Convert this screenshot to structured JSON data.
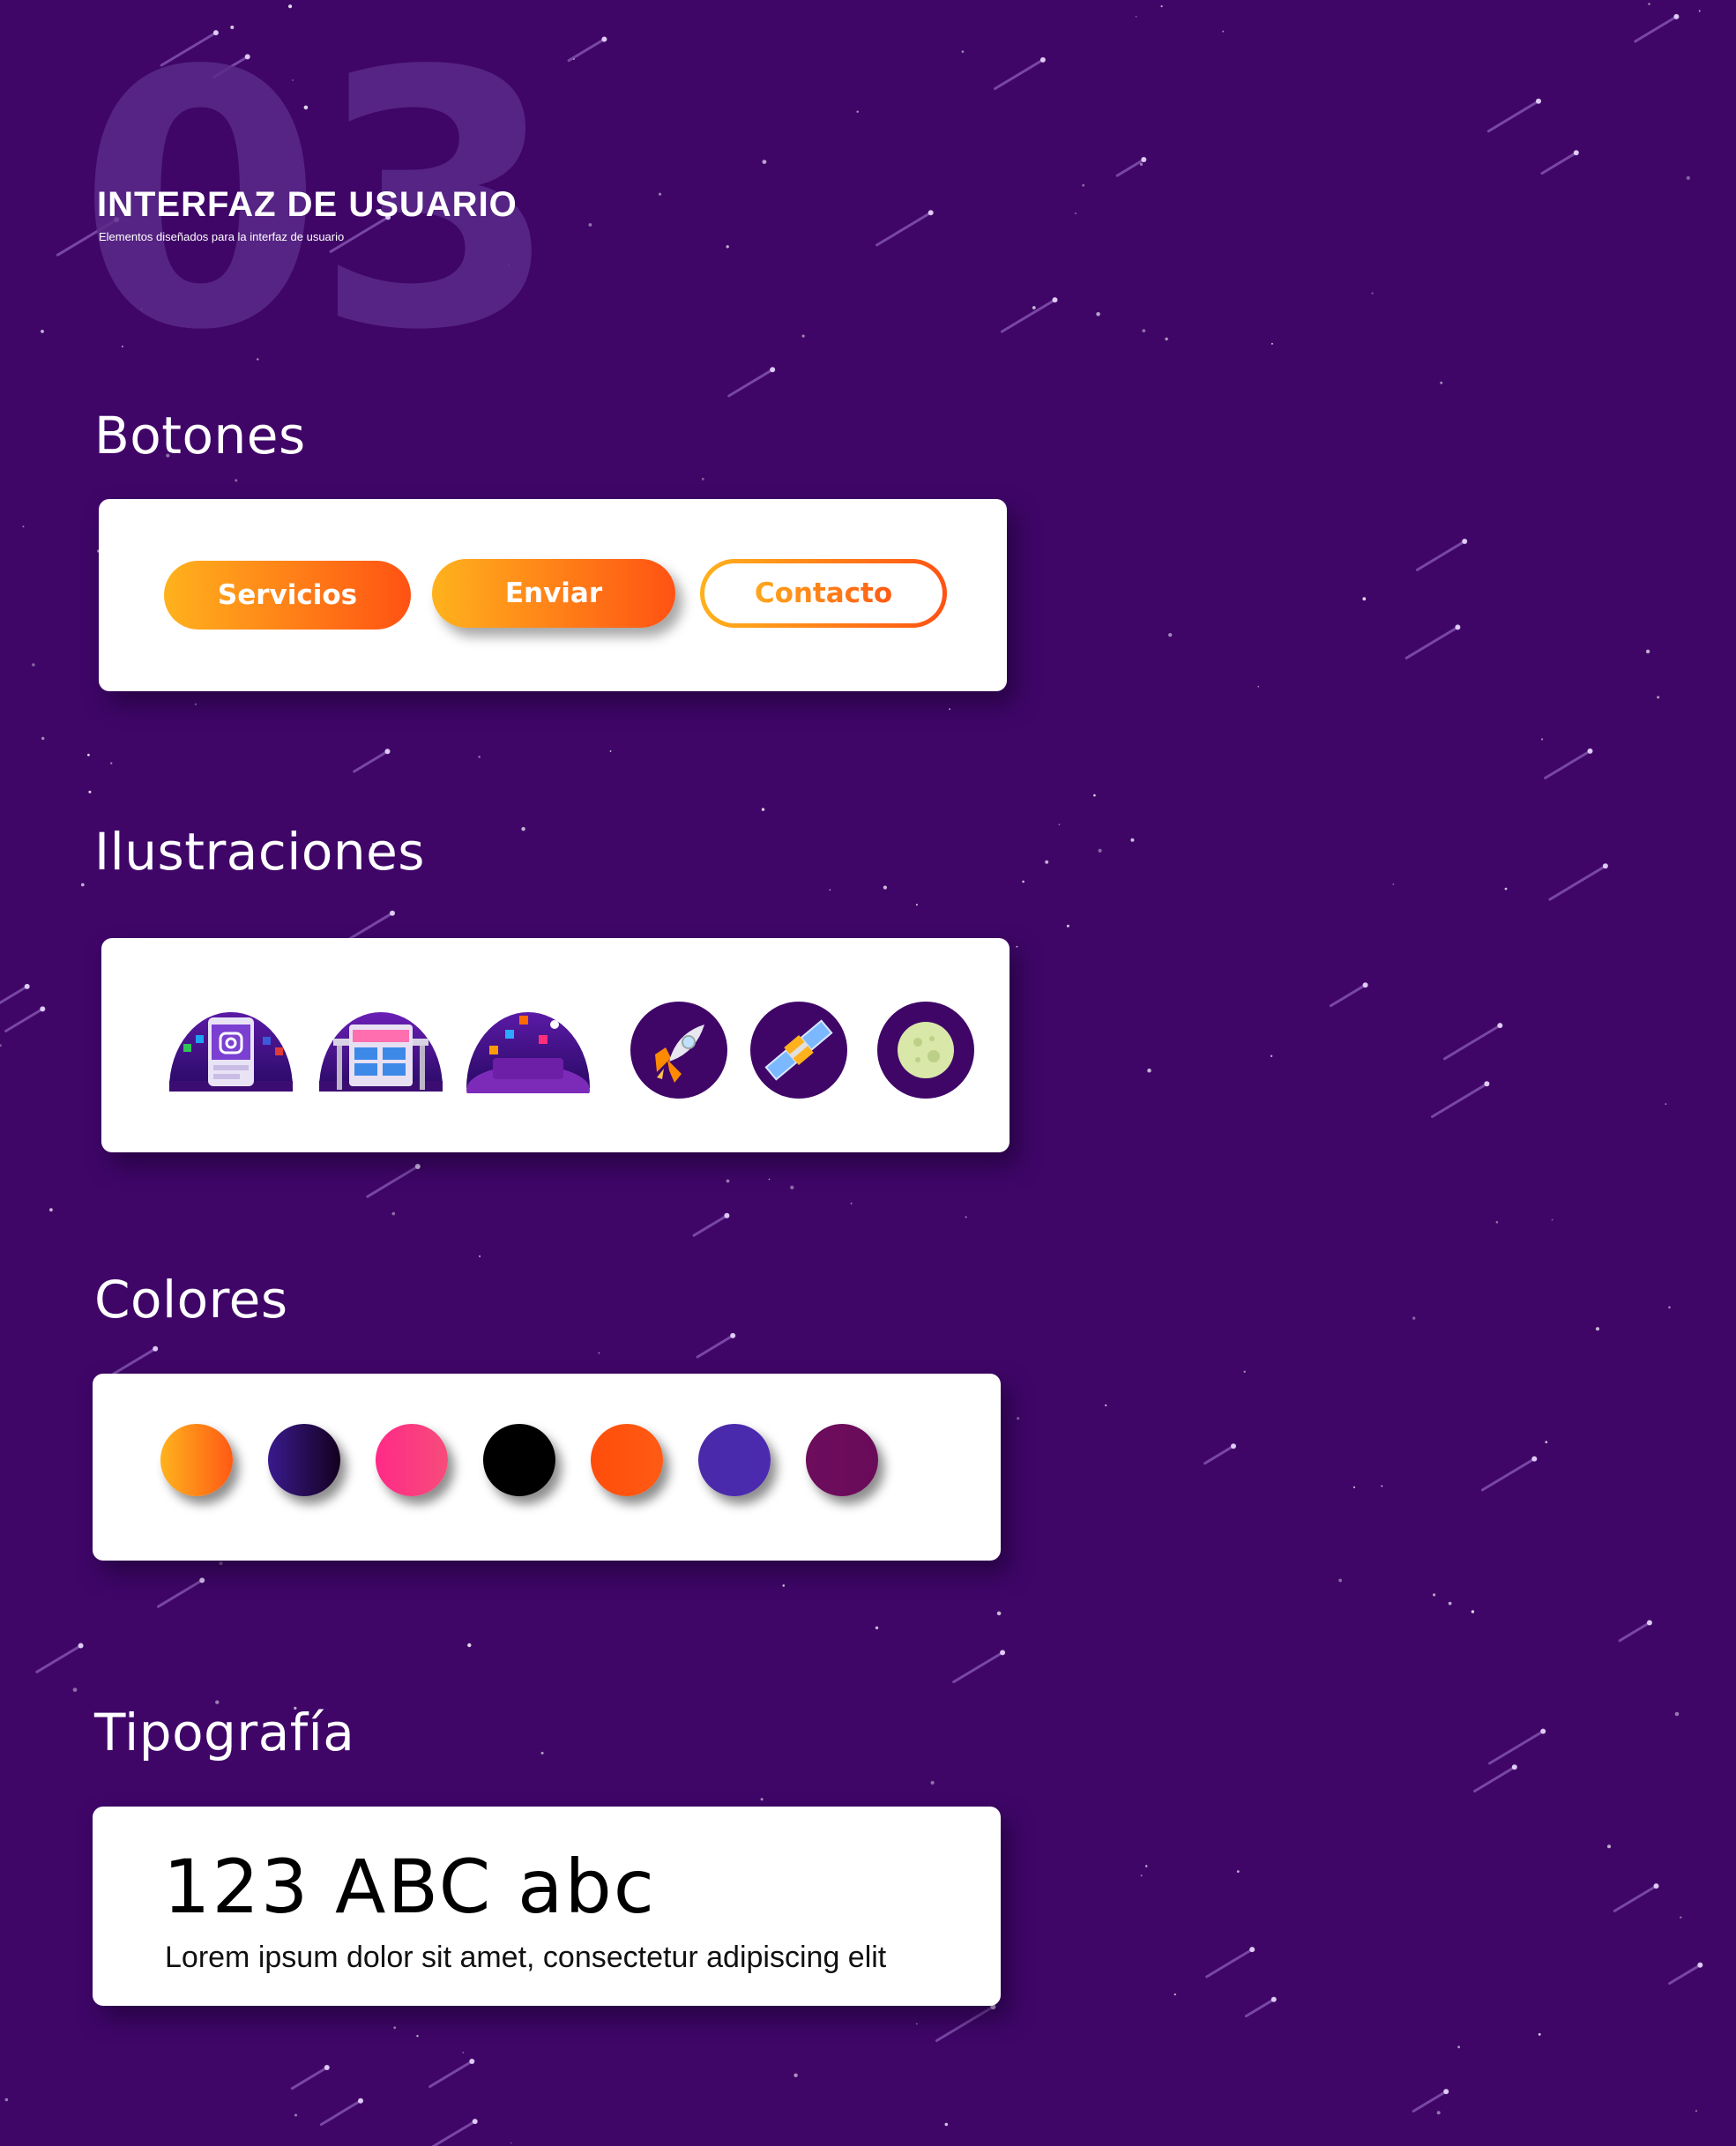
{
  "hero": {
    "number": "03",
    "title": "INTERFAZ DE USUARIO",
    "subtitle": "Elementos diseñados para la interfaz de usuario"
  },
  "sections": {
    "buttons": {
      "title": "Botones",
      "items": [
        "Servicios",
        "Enviar",
        "Contacto"
      ]
    },
    "illustrations": {
      "title": "Ilustraciones",
      "items": [
        "instagram-scene-icon",
        "website-scene-icon",
        "adobe-apps-scene-icon",
        "rocket-icon",
        "satellite-icon",
        "moon-icon"
      ]
    },
    "colors": {
      "title": "Colores",
      "swatches": [
        {
          "from": "#ffb21d",
          "to": "#ff5a14"
        },
        {
          "from": "#3a1a8e",
          "to": "#14001f"
        },
        {
          "from": "#ff2a87",
          "to": "#f74c7a"
        },
        {
          "from": "#000000",
          "to": "#000000"
        },
        {
          "from": "#ff4d0a",
          "to": "#ff5b14"
        },
        {
          "from": "#4a2aa8",
          "to": "#4b2ab0"
        },
        {
          "from": "#6d0d5c",
          "to": "#6a0b5a"
        }
      ]
    },
    "typography": {
      "title": "Tipografía",
      "sample_large": "123 ABC abc",
      "sample_small": "Lorem ipsum dolor sit amet, consectetur adipiscing elit"
    }
  },
  "colors": {
    "background": "#3f0668",
    "accent_start": "#ffb21d",
    "accent_end": "#ff5213"
  }
}
